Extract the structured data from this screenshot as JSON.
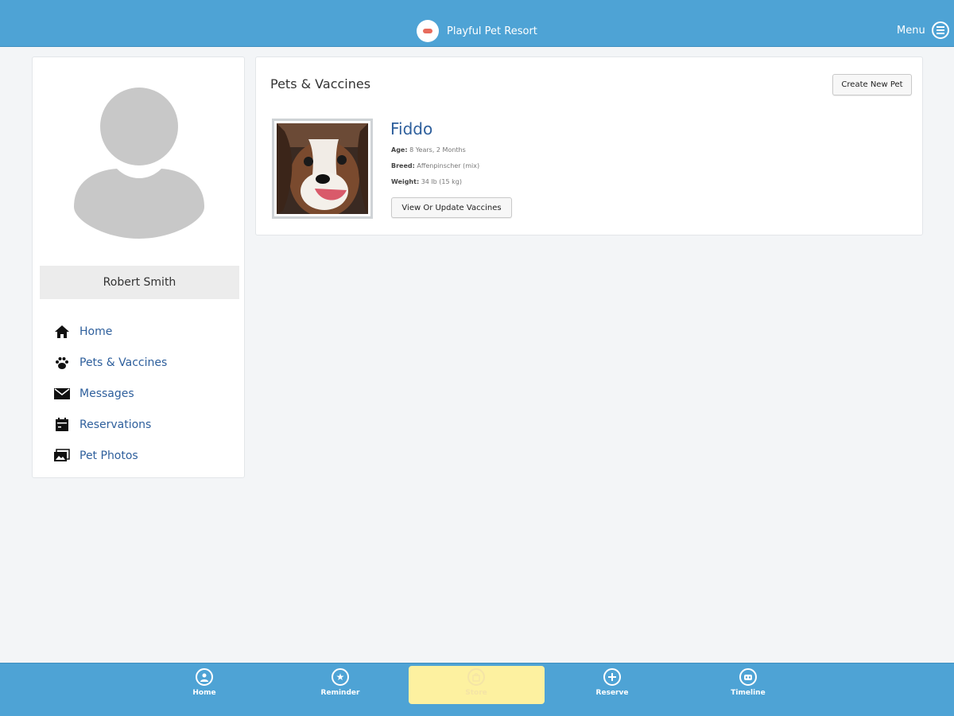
{
  "header": {
    "title": "Playful Pet Resort",
    "menu_label": "Menu"
  },
  "profile": {
    "name": "Robert Smith"
  },
  "sidebar": {
    "items": [
      {
        "label": "Home",
        "icon": "home-icon"
      },
      {
        "label": "Pets & Vaccines",
        "icon": "paw-icon"
      },
      {
        "label": "Messages",
        "icon": "envelope-icon"
      },
      {
        "label": "Reservations",
        "icon": "calendar-icon"
      },
      {
        "label": "Pet Photos",
        "icon": "photos-icon"
      }
    ]
  },
  "main": {
    "title": "Pets & Vaccines",
    "create_button": "Create New Pet",
    "pet": {
      "name": "Fiddo",
      "age_label": "Age:",
      "age_value": "8 Years, 2 Months",
      "breed_label": "Breed:",
      "breed_value": "Affenpinscher (mix)",
      "weight_label": "Weight:",
      "weight_value": "34 lb (15 kg)",
      "vaccines_button": "View Or Update Vaccines"
    }
  },
  "bottom_nav": {
    "tabs": [
      {
        "label": "Home",
        "icon": "home-circle-icon"
      },
      {
        "label": "Reminder",
        "icon": "star-circle-icon"
      },
      {
        "label": "Store",
        "icon": "store-circle-icon",
        "active": true
      },
      {
        "label": "Reserve",
        "icon": "plus-circle-icon"
      },
      {
        "label": "Timeline",
        "icon": "timeline-circle-icon"
      }
    ]
  },
  "colors": {
    "bar_blue": "#4ea3d5",
    "link_blue": "#2e5f9c",
    "active_tab": "#fdf1a0",
    "page_bg": "#f3f5f7"
  }
}
